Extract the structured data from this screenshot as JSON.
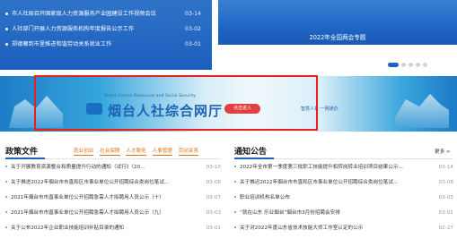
{
  "top_news": [
    {
      "title": "市人社局召开国家级人力资源服务产业园建设工作视频会议",
      "date": "03-14"
    },
    {
      "title": "人社部门开展人力资源服务机构年度报告公示工作",
      "date": "03-02"
    },
    {
      "title": "郑德雁到市里推进和谐劳动关系就业工作",
      "date": "03-01"
    }
  ],
  "top_banner": {
    "caption": "2022年全国两会专题"
  },
  "mid_banner": {
    "subtitle": "Smart Human Resources and Social Security",
    "brand": "烟台人社综合网厅",
    "enter_label": "点击进入",
    "right_text": "智慧人社·一网通办"
  },
  "policy": {
    "title": "政策文件",
    "tabs": [
      "就业创业",
      "社会保障",
      "人才服务",
      "人事管理",
      "劳动关系"
    ],
    "items": [
      {
        "title": "关于开展教育资源整合和质量提升行动的通知（试行》（20…",
        "date": "03-10"
      },
      {
        "title": "关于推进2022年烟台市市直和区市事业单位公开招聘综合类岗位笔试…",
        "date": "03-08"
      },
      {
        "title": "2021年烟台市市直事业单位公开招聘急需人才拟聘用人员公示（十）",
        "date": "03-07"
      },
      {
        "title": "2021年烟台市市直事业单位公开招聘急需人才拟聘用人员公示（九）",
        "date": "03-03"
      },
      {
        "title": "关于公布2022年企业职业技能培训补贴目录的通知",
        "date": "03-01"
      }
    ]
  },
  "notice": {
    "title": "通知公告",
    "more": "更多 >",
    "items": [
      {
        "title": "2022年全市第一季度第三批职工技能提升和转岗转业培训项目结果公示…",
        "date": "03-14"
      },
      {
        "title": "关于推迟2022年烟台市市直和区市事业单位公开招聘综合类岗位笔试…",
        "date": "03-08"
      },
      {
        "title": "职业培训机构名单公布",
        "date": "03-03"
      },
      {
        "title": "“就在山东 乐业烟台”烟台市3月份招聘会安排",
        "date": "03-01"
      },
      {
        "title": "关于对2022年度山东省技术技能大师工作室认定的公示",
        "date": "02-27"
      }
    ]
  }
}
